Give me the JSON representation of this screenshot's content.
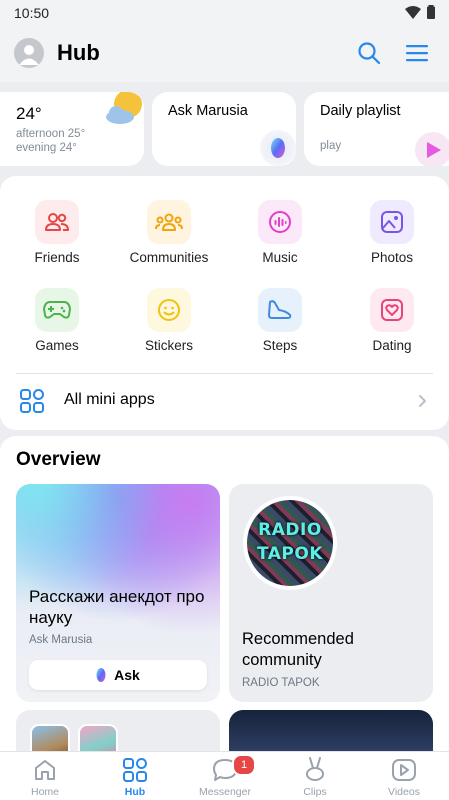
{
  "status_bar": {
    "time": "10:50"
  },
  "header": {
    "title": "Hub"
  },
  "widgets": {
    "weather": {
      "temperature": "24°",
      "afternoon": "afternoon 25°",
      "evening": "evening 24°"
    },
    "marusia": {
      "title": "Ask Marusia"
    },
    "playlist": {
      "title": "Daily playlist",
      "subtitle": "play"
    }
  },
  "apps": [
    {
      "label": "Friends",
      "icon": "friends-icon",
      "color": "#e64646",
      "bg": "#fdeceb"
    },
    {
      "label": "Communities",
      "icon": "communities-icon",
      "color": "#f2a20c",
      "bg": "#fef4e0"
    },
    {
      "label": "Music",
      "icon": "music-icon",
      "color": "#e040c8",
      "bg": "#fbe8f8"
    },
    {
      "label": "Photos",
      "icon": "photos-icon",
      "color": "#7a54e8",
      "bg": "#efeafd"
    },
    {
      "label": "Games",
      "icon": "games-icon",
      "color": "#4bb34b",
      "bg": "#e8f6e8"
    },
    {
      "label": "Stickers",
      "icon": "stickers-icon",
      "color": "#f2c20c",
      "bg": "#fef8de"
    },
    {
      "label": "Steps",
      "icon": "steps-icon",
      "color": "#3f8ae0",
      "bg": "#e7f1fc"
    },
    {
      "label": "Dating",
      "icon": "dating-icon",
      "color": "#e6457a",
      "bg": "#fde9ef"
    }
  ],
  "all_mini_apps": {
    "label": "All mini apps"
  },
  "overview": {
    "title": "Overview",
    "marusia_card": {
      "question": "Расскажи анекдот про науку",
      "source": "Ask Marusia",
      "button": "Ask"
    },
    "community_card": {
      "logo_text_1": "RADIO",
      "logo_text_2": "TAPOK",
      "title": "Recommended community",
      "source": "RADIO TAPOK"
    }
  },
  "tabbar": {
    "tabs": [
      {
        "label": "Home",
        "icon": "home-icon"
      },
      {
        "label": "Hub",
        "icon": "hub-icon",
        "active": true
      },
      {
        "label": "Messenger",
        "icon": "messenger-icon",
        "badge": "1"
      },
      {
        "label": "Clips",
        "icon": "clips-icon"
      },
      {
        "label": "Videos",
        "icon": "videos-icon"
      }
    ]
  },
  "colors": {
    "accent": "#2688eb",
    "background": "#ebedf0",
    "badge": "#e64646"
  }
}
